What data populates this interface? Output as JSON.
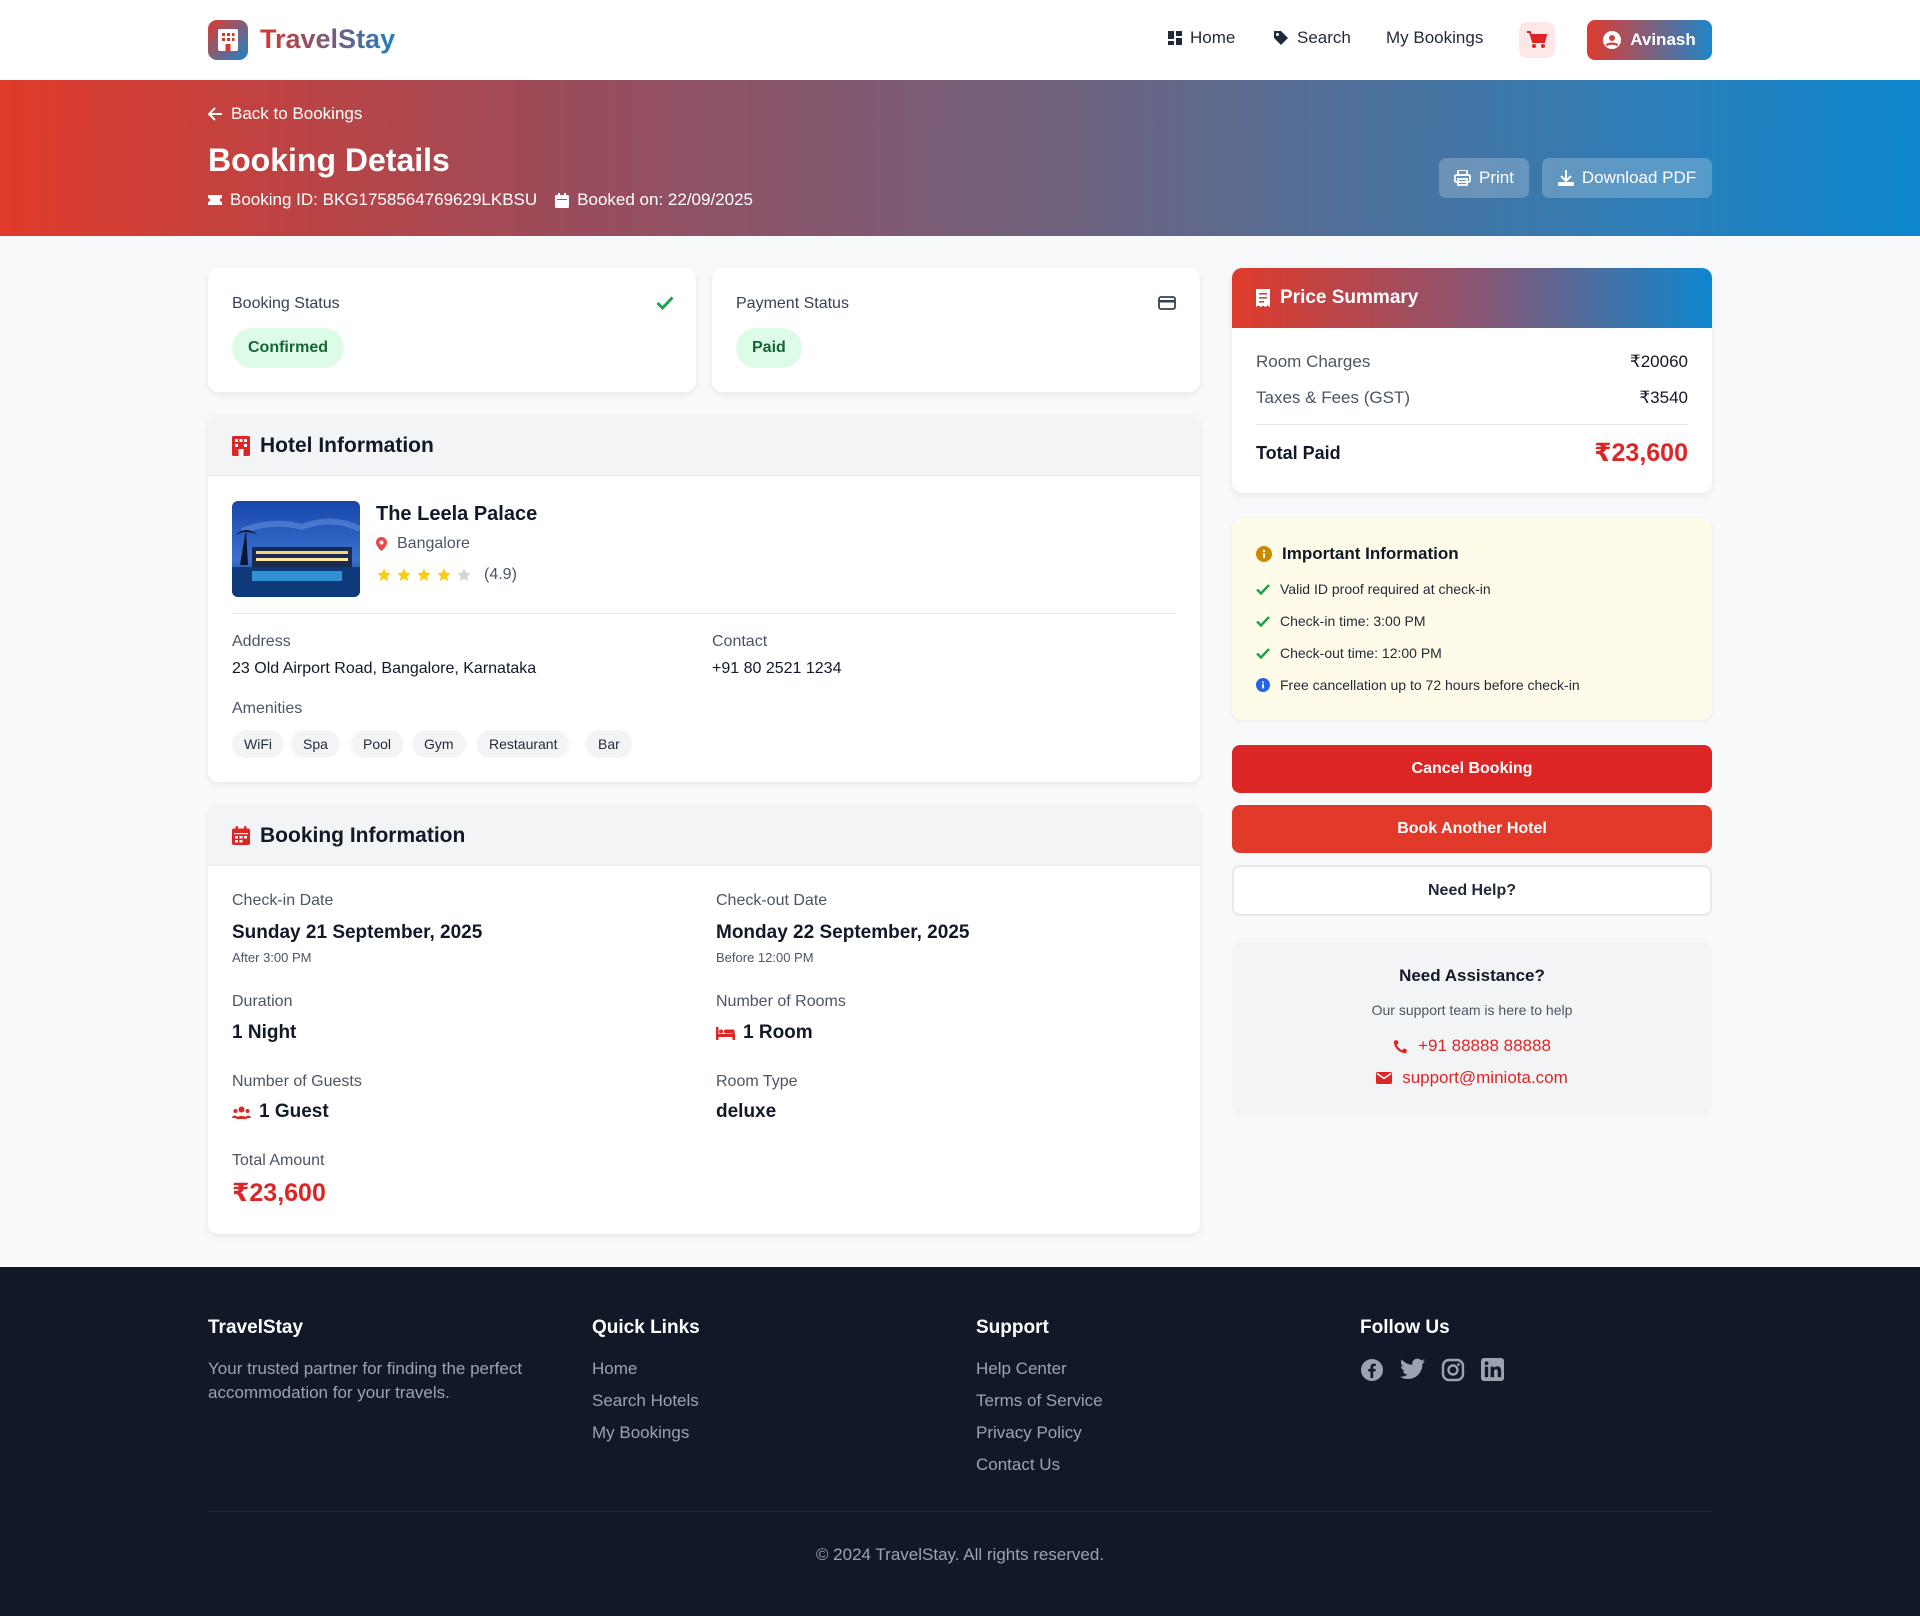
{
  "nav": {
    "brand": "TravelStay",
    "home": "Home",
    "search": "Search",
    "my_bookings": "My Bookings",
    "user": "Avinash"
  },
  "hero": {
    "back": "Back to Bookings",
    "title": "Booking Details",
    "booking_id": "Booking ID: BKG1758564769629LKBSU",
    "booked_on": "Booked on: 22/09/2025",
    "print": "Print",
    "download": "Download PDF"
  },
  "status": {
    "booking_label": "Booking Status",
    "booking_value": "Confirmed",
    "payment_label": "Payment Status",
    "payment_value": "Paid"
  },
  "hotel": {
    "section_title": "Hotel Information",
    "name": "The Leela Palace",
    "city": "Bangalore",
    "rating": 4.9,
    "rating_text": "(4.9)",
    "address_label": "Address",
    "address": "23 Old Airport Road, Bangalore, Karnataka",
    "contact_label": "Contact",
    "contact": "+91 80 2521 1234",
    "amenities_label": "Amenities",
    "amenities": [
      "WiFi",
      "Spa",
      "Pool",
      "Gym",
      "Restaurant",
      "Bar"
    ]
  },
  "booking": {
    "section_title": "Booking Information",
    "checkin_label": "Check-in Date",
    "checkin": "Sunday 21 September, 2025",
    "checkin_note": "After 3:00 PM",
    "checkout_label": "Check-out Date",
    "checkout": "Monday 22 September, 2025",
    "checkout_note": "Before 12:00 PM",
    "duration_label": "Duration",
    "duration": "1 Night",
    "rooms_label": "Number of Rooms",
    "rooms": "1 Room",
    "guests_label": "Number of Guests",
    "guests": "1 Guest",
    "room_type_label": "Room Type",
    "room_type": "deluxe",
    "total_label": "Total Amount",
    "total": "₹23,600"
  },
  "price": {
    "title": "Price Summary",
    "room_label": "Room Charges",
    "room_value": "₹20060",
    "tax_label": "Taxes & Fees (GST)",
    "tax_value": "₹3540",
    "total_label": "Total Paid",
    "total_value": "₹23,600"
  },
  "important": {
    "title": "Important Information",
    "items": [
      "Valid ID proof required at check-in",
      "Check-in time: 3:00 PM",
      "Check-out time: 12:00 PM",
      "Free cancellation up to 72 hours before check-in"
    ]
  },
  "actions": {
    "cancel": "Cancel Booking",
    "book_another": "Book Another Hotel",
    "help": "Need Help?"
  },
  "assist": {
    "title": "Need Assistance?",
    "subtitle": "Our support team is here to help",
    "phone": "+91 88888 88888",
    "email": "support@miniota.com"
  },
  "footer": {
    "brand": "TravelStay",
    "tagline_1": "Your trusted partner for finding the perfect",
    "tagline_2": "accommodation for your travels.",
    "quick_title": "Quick Links",
    "quick": [
      "Home",
      "Search Hotels",
      "My Bookings"
    ],
    "support_title": "Support",
    "support": [
      "Help Center",
      "Terms of Service",
      "Privacy Policy",
      "Contact Us"
    ],
    "follow_title": "Follow Us",
    "copyright": "© 2024 TravelStay. All rights reserved."
  },
  "colors": {
    "primary_red": "#e03a2e",
    "primary_blue": "#0c86ce",
    "cancel_red": "#dc2626",
    "success_green": "#16a34a",
    "footer_bg": "#111827"
  },
  "icons": [
    "hotel-icon",
    "home-icon",
    "tag-icon",
    "cart-icon",
    "user-circle-icon",
    "arrow-left-icon",
    "ticket-icon",
    "calendar-icon",
    "printer-icon",
    "download-icon",
    "check-icon",
    "credit-card-icon",
    "map-pin-icon",
    "star-icon",
    "receipt-icon",
    "info-icon",
    "bed-icon",
    "users-icon",
    "phone-icon",
    "envelope-icon",
    "facebook-icon",
    "twitter-icon",
    "instagram-icon",
    "linkedin-icon"
  ]
}
